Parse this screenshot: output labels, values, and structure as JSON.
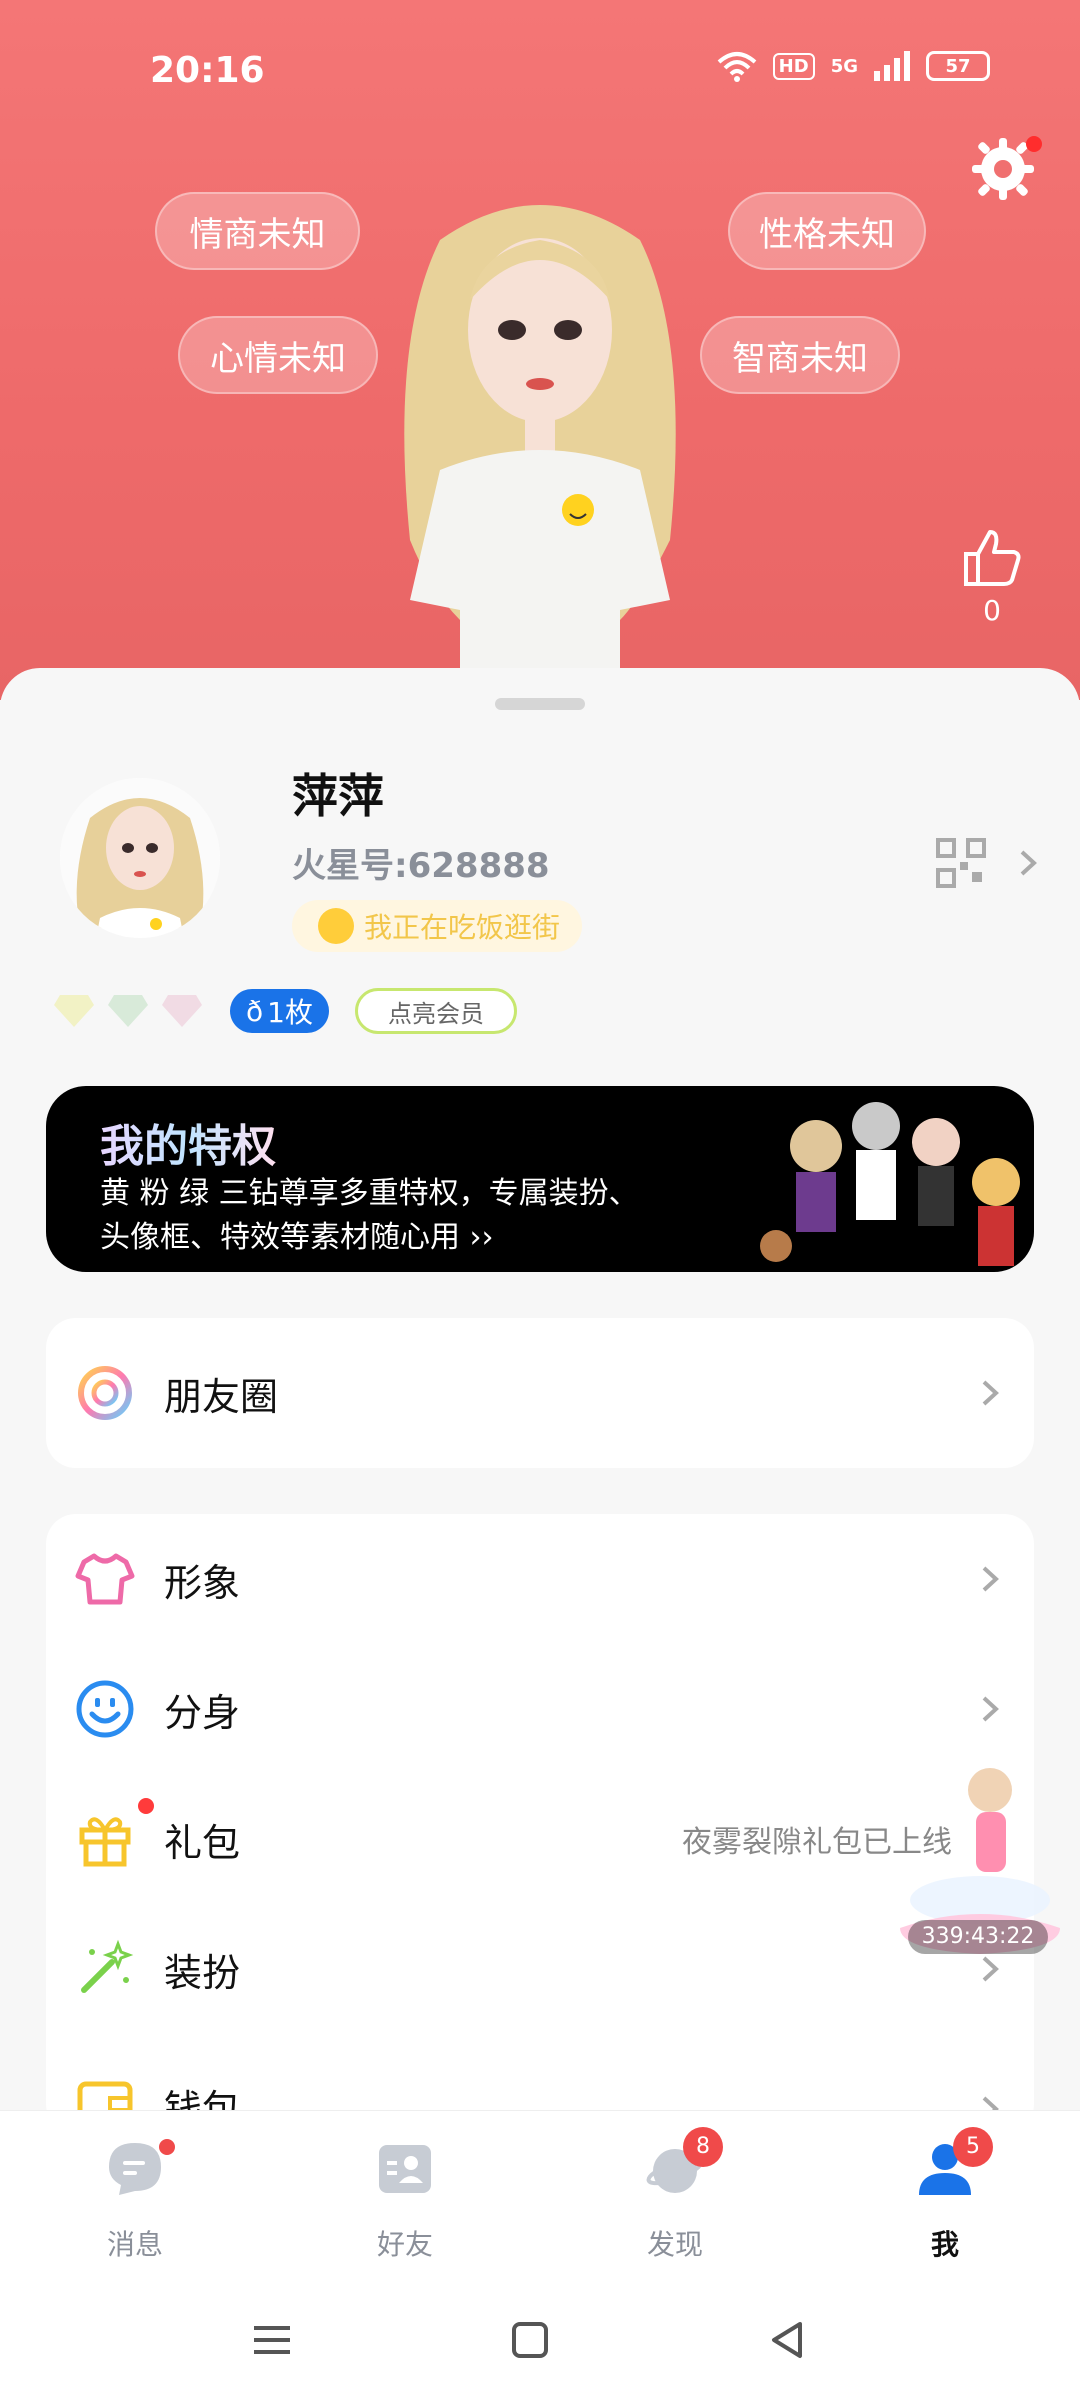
{
  "status_bar": {
    "time": "20:16",
    "hd": "HD",
    "network": "5G",
    "battery": "57"
  },
  "hero": {
    "bubbles": [
      "情商未知",
      "心情未知",
      "性格未知",
      "智商未知"
    ],
    "like_count": "0",
    "colors": {
      "background": "#f47676"
    }
  },
  "profile": {
    "name": "萍萍",
    "id_label": "火星号:628888",
    "mood": "我正在吃饭逛街",
    "medal": "1枚",
    "vip_button": "点亮会员"
  },
  "privilege": {
    "title": "我的特权",
    "description": "黄 粉 绿 三钻尊享多重特权，专属装扮、头像框、特效等素材随心用 ››"
  },
  "menu": {
    "friends_circle": "朋友圈",
    "items": [
      {
        "label": "形象",
        "icon": "tshirt-icon"
      },
      {
        "label": "分身",
        "icon": "smile-icon"
      },
      {
        "label": "礼包",
        "icon": "gift-icon",
        "note": "夜雾裂隙礼包已上线"
      },
      {
        "label": "装扮",
        "icon": "magic-wand-icon"
      },
      {
        "label": "钱包",
        "icon": "wallet-icon"
      }
    ]
  },
  "float_widget": {
    "countdown": "339:43:22"
  },
  "tabbar": {
    "tabs": [
      {
        "label": "消息",
        "badge": ""
      },
      {
        "label": "好友",
        "badge": ""
      },
      {
        "label": "发现",
        "badge": "8"
      },
      {
        "label": "我",
        "badge": "5"
      }
    ]
  }
}
